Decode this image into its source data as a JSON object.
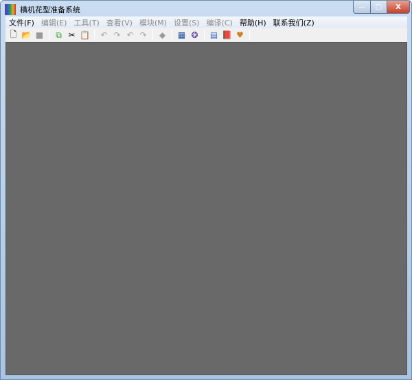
{
  "window": {
    "title": "横机花型准备系统",
    "controls": {
      "minimize": "—",
      "maximize": "□",
      "close": "X"
    }
  },
  "menu": [
    {
      "label": "文件(F)",
      "enabled": true
    },
    {
      "label": "编辑(E)",
      "enabled": false
    },
    {
      "label": "工具(T)",
      "enabled": false
    },
    {
      "label": "查看(V)",
      "enabled": false
    },
    {
      "label": "模块(M)",
      "enabled": false
    },
    {
      "label": "设置(S)",
      "enabled": false
    },
    {
      "label": "编译(C)",
      "enabled": false
    },
    {
      "label": "帮助(H)",
      "enabled": true
    },
    {
      "label": "联系我们(Z)",
      "enabled": true
    }
  ],
  "toolbar": {
    "new": "🗋",
    "open": "📂",
    "save": "■",
    "copy": "⧉",
    "cut": "✂",
    "paste": "📋",
    "undo": "↶",
    "redo": "↷",
    "undo_opt": "↶",
    "redo_opt": "↷",
    "tool": "◆",
    "pattern": "▦",
    "module": "❂",
    "calculator": "▤",
    "help_book": "📕",
    "contact": "♥"
  }
}
